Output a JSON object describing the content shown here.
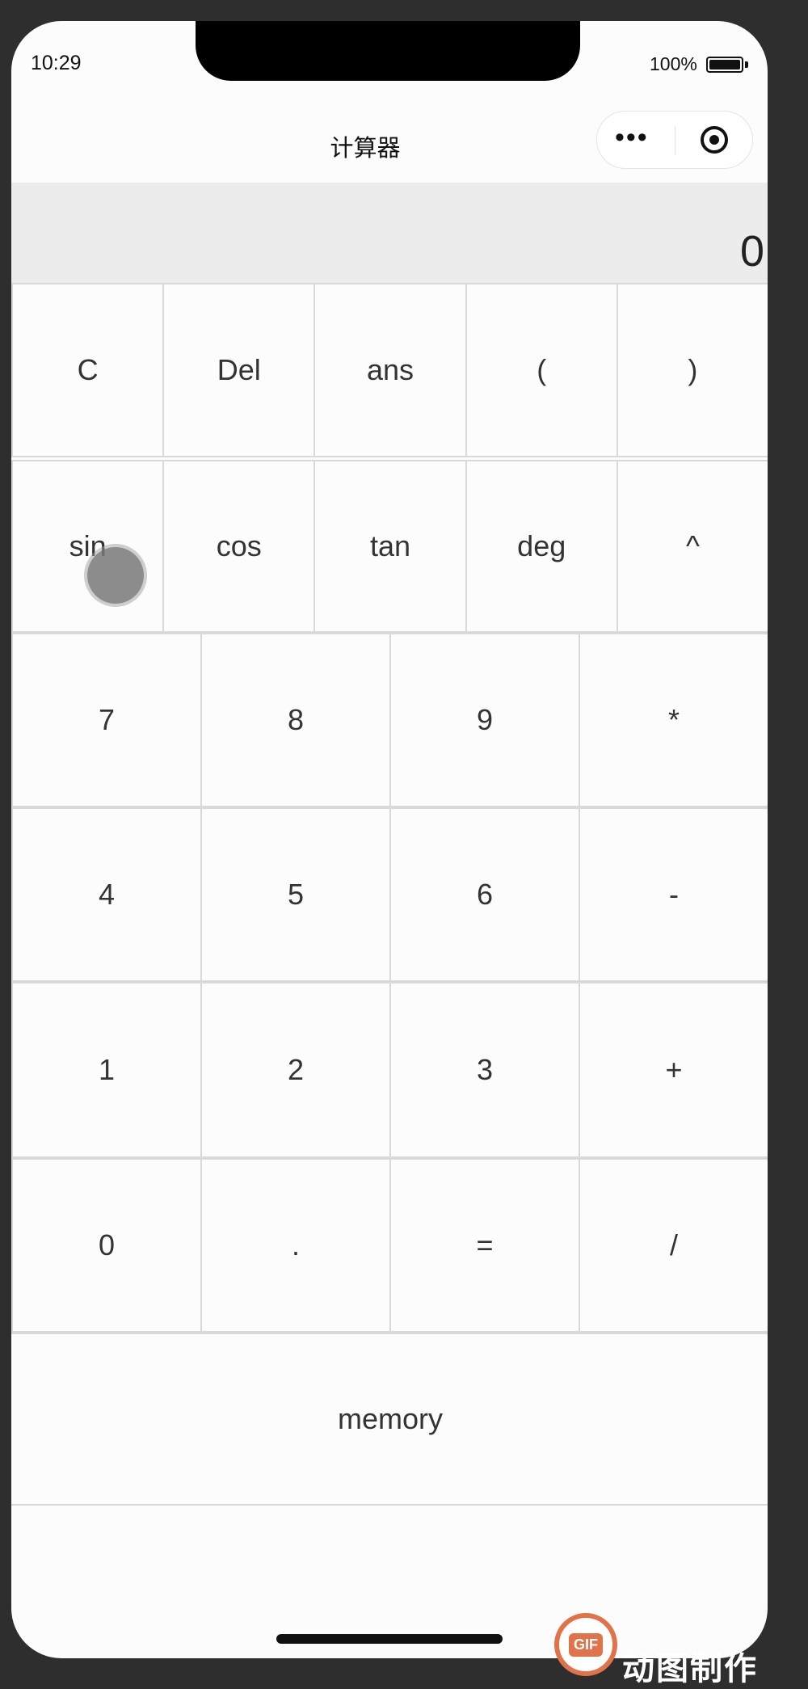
{
  "status": {
    "time": "10:29",
    "battery": "100%"
  },
  "nav": {
    "title": "计算器"
  },
  "display": {
    "value": "0"
  },
  "keys": {
    "row1": [
      "C",
      "Del",
      "ans",
      "(",
      ")"
    ],
    "row2": [
      "sin",
      "cos",
      "tan",
      "deg",
      "^"
    ],
    "row3": [
      "7",
      "8",
      "9",
      "*"
    ],
    "row4": [
      "4",
      "5",
      "6",
      "-"
    ],
    "row5": [
      "1",
      "2",
      "3",
      "+"
    ],
    "row6": [
      "0",
      ".",
      "=",
      "/"
    ],
    "row7": [
      "memory"
    ]
  },
  "watermark": {
    "badge": "GIF",
    "text": "动图制作"
  }
}
